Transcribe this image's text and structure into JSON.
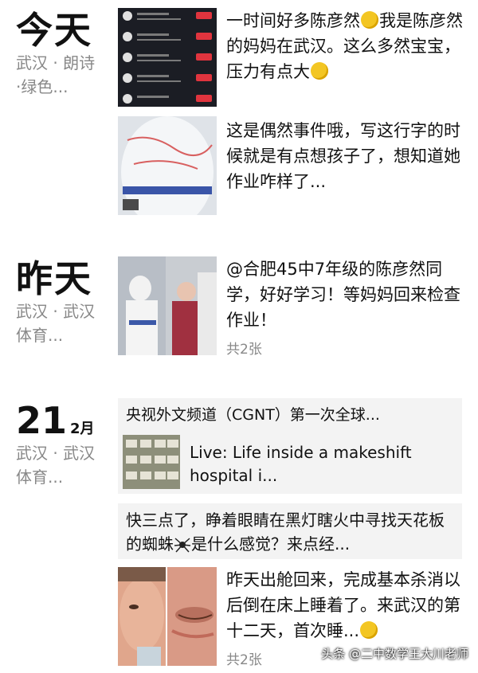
{
  "sections": [
    {
      "day": "今天",
      "location": "武汉 · 朗诗·绿色...",
      "posts": [
        {
          "text": "一时间好多陈彦然",
          "text2": "我是陈彦然的妈妈在武汉。这么多然宝宝，压力有点大"
        },
        {
          "text": "这是偶然事件哦，写这行字的时候就是有点想孩子了，想知道她作业咋样了..."
        }
      ]
    },
    {
      "day": "昨天",
      "location": "武汉 · 武汉体育...",
      "posts": [
        {
          "text": "@合肥45中7年级的陈彦然同学，好好学习！等妈妈回来检查作业！",
          "count": "共2张"
        }
      ]
    },
    {
      "day": "21",
      "month": "2月",
      "location": "武汉 · 武汉体育...",
      "share": {
        "title": "央视外文频道（CGNT）第一次全球...",
        "link": "Live: Life inside a makeshift hospital i..."
      },
      "posts": [
        {
          "text": "快三点了，睁着眼睛在黑灯瞎火中寻找天花板的蜘蛛",
          "text2": "是什么感觉？来点经..."
        },
        {
          "text": "昨天出舱回来，完成基本杀消以后倒在床上睡着了。来武汉的第十二天，首次睡...",
          "count": "共2张"
        }
      ]
    }
  ],
  "watermark": "头条 @二中数学王大川老师",
  "colors": {
    "text": "#111111",
    "meta": "#888888",
    "card_bg": "#f3f3f3"
  }
}
